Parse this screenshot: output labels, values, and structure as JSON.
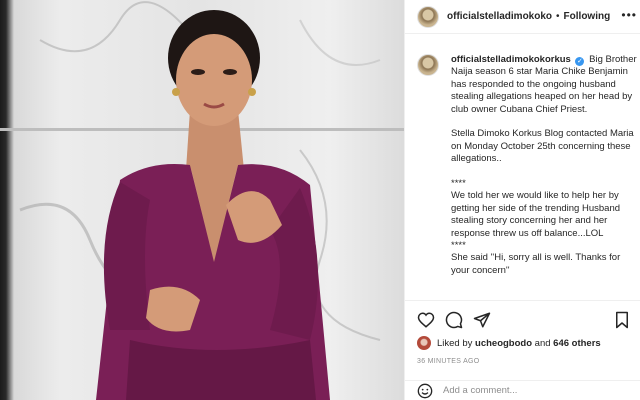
{
  "post": {
    "username": "officialstelladimokoko",
    "follow_label": "Following",
    "separator": "•",
    "more_icon": "more-options-icon"
  },
  "caption": {
    "username": "officialstelladimokokorkus",
    "verified_icon": "verified-badge-icon",
    "paragraphs": [
      "Big Brother Naija season 6 star Maria Chike Benjamin has responded to the ongoing husband stealing allegations heaped on her head by club owner Cubana Chief Priest.",
      "Stella Dimoko Korkus Blog contacted Maria on Monday October 25th concerning these allegations..",
      "****\nWe told her we would like to help her by getting her side of the trending Husband stealing story concerning her and her response threw us off balance...LOL\n****\nShe said ''Hi, sorry all is well. Thanks for your concern''"
    ]
  },
  "actions": {
    "icons": [
      "heart-icon",
      "comment-icon",
      "share-icon",
      "bookmark-icon"
    ]
  },
  "likes": {
    "prefix": "Liked by",
    "user": "ucheogbodo",
    "middle": "and",
    "count": "646 others"
  },
  "timestamp": "36 MINUTES AGO",
  "comment_box": {
    "placeholder": "Add a comment..."
  },
  "colors": {
    "dress": "#7a1f56",
    "verified": "#3897f0",
    "muted": "#8e8e8e"
  }
}
